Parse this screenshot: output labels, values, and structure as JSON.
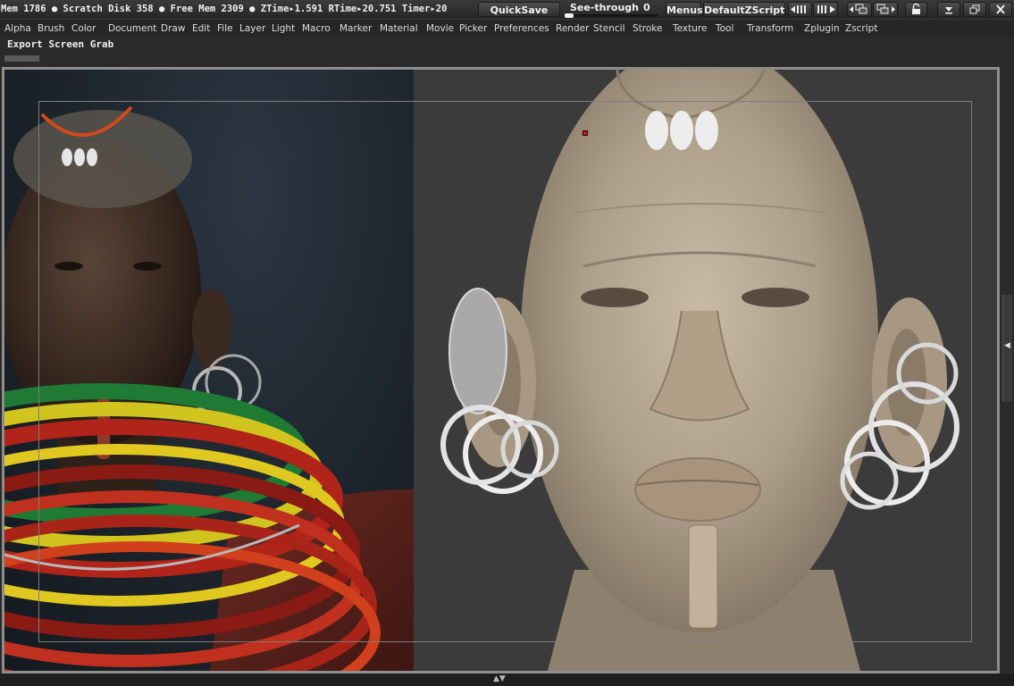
{
  "statusbar": {
    "text": "Mem 1786 ● Scratch Disk 358 ● Free Mem 2309 ● ZTime▸1.591 RTime▸20.751 Timer▸20"
  },
  "toolbar": {
    "quicksave_label": "QuickSave",
    "seethrough_label": "See-through",
    "seethrough_value": "0",
    "seethrough_level": 0,
    "menus_label": "Menus",
    "script_label": "DefaultZScript"
  },
  "menubar": {
    "items": [
      "Alpha",
      "Brush",
      "Color",
      "Document",
      "Draw",
      "Edit",
      "File",
      "Layer",
      "Light",
      "Macro",
      "Marker",
      "Material",
      "Movie",
      "Picker",
      "Preferences",
      "Render",
      "Stencil",
      "Stroke",
      "Texture",
      "Tool",
      "Transform",
      "Zplugin",
      "Zscript"
    ]
  },
  "subbar": {
    "export_label": "Export Screen Grab"
  },
  "icons": {
    "status_bullet": "bullet-dot",
    "decrease_width": "shrink-icon",
    "increase_width": "expand-icon",
    "window_tile1": "tile-icon",
    "window_tile2": "tile-alt-icon",
    "lock": "lock-icon",
    "minimize": "minimize-icon",
    "restore": "restore-icon",
    "close": "close-icon"
  },
  "colors": {
    "chrome_bg": "#262626",
    "canvas_bg": "#3b3b3b",
    "frame": "#8e8e8e",
    "clay": "#b7a894",
    "ring": "#e6e6e6",
    "marker": "#c0202a"
  }
}
